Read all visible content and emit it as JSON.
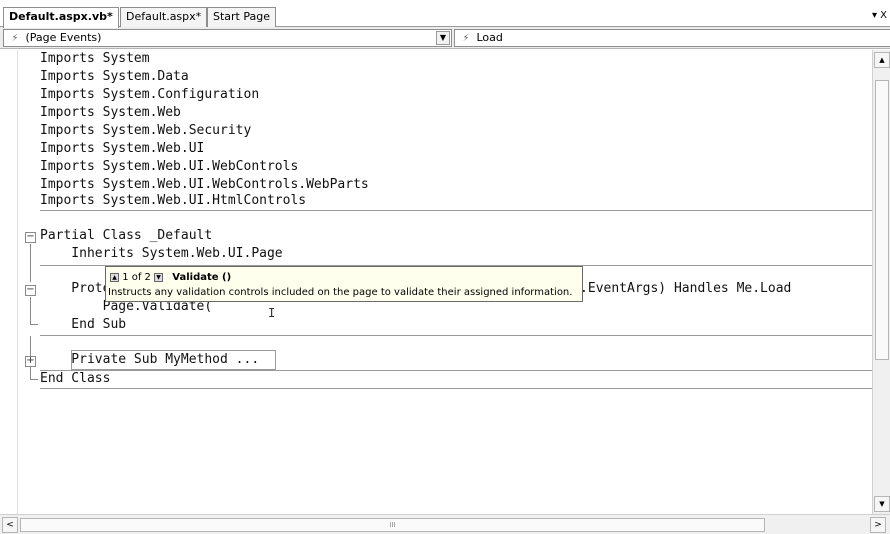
{
  "tabs": [
    {
      "label": "Default.aspx.vb*",
      "active": true
    },
    {
      "label": "Default.aspx*",
      "active": false
    },
    {
      "label": "Start Page",
      "active": false
    }
  ],
  "tab_menu_glyph": "▾ X",
  "dropdowns": {
    "left": {
      "icon": "event-icon",
      "value": "(Page Events)"
    },
    "right": {
      "icon": "event-icon",
      "value": "Load"
    }
  },
  "code": {
    "imports": [
      "Imports System",
      "Imports System.Data",
      "Imports System.Configuration",
      "Imports System.Web",
      "Imports System.Web.Security",
      "Imports System.Web.UI",
      "Imports System.Web.UI.WebControls",
      "Imports System.Web.UI.WebControls.WebParts",
      "Imports System.Web.UI.HtmlControls"
    ],
    "class_line": "Partial Class _Default",
    "inherits_line": "    Inherits System.Web.UI.Page",
    "sub_line": "    Protected Sub Page_Load(ByVal sender As Object, ByVal e As System.EventArgs) Handles Me.Load",
    "call_line": "        Page.Validate(",
    "end_sub_line": "    End Sub",
    "collapsed_line": "    Private Sub MyMethod ...",
    "end_class_line": "End Class"
  },
  "tooltip": {
    "counter": "1 of 2",
    "signature": "Validate ()",
    "description": "Instructs any validation controls included on the page to validate their assigned information."
  },
  "scrollbar": {
    "grip": "III"
  },
  "colors": {
    "tooltip_bg": "#ffffee",
    "tab_active_bg": "#ffffff",
    "toolbar_bg": "#ececec"
  }
}
